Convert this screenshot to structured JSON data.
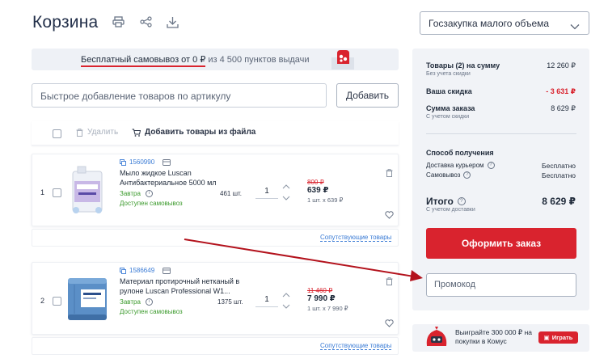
{
  "header": {
    "title": "Корзина",
    "icons": [
      "print-icon",
      "share-icon",
      "download-icon"
    ]
  },
  "promo": {
    "highlight": "Бесплатный самовывоз от 0 ₽",
    "rest": " из 4 500 пунктов выдачи"
  },
  "quick_add": {
    "placeholder": "Быстрое добавление товаров по артикулу",
    "button": "Добавить"
  },
  "toolbar": {
    "delete": "Удалить",
    "add_from_file": "Добавить товары из файла"
  },
  "items": [
    {
      "index": "1",
      "sku": "1560990",
      "name": "Мыло жидкое Luscan Антибактериальное 5000 мл",
      "delivery": "Завтра",
      "pickup": "Доступен самовывоз",
      "stock": "461 шт.",
      "qty": "1",
      "old_price": "800 ₽",
      "price": "639 ₽",
      "unit_price": "1 шт. x 639 ₽",
      "related": "Сопутствующие товары"
    },
    {
      "index": "2",
      "sku": "1586649",
      "name": "Материал протирочный нетканый в рулоне Luscan Professional W1...",
      "delivery": "Завтра",
      "pickup": "Доступен самовывоз",
      "stock": "1375 шт.",
      "qty": "1",
      "old_price": "11 460 ₽",
      "price": "7 990 ₽",
      "unit_price": "1 шт. x 7 990 ₽",
      "related": "Сопутствующие товары"
    }
  ],
  "purchase_type": {
    "selected": "Госзакупка малого объема"
  },
  "summary": {
    "goods_label": "Товары (2) на сумму",
    "goods_sub": "Без учета скидки",
    "goods_value": "12 260 ₽",
    "discount_label": "Ваша скидка",
    "discount_value": "- 3 631 ₽",
    "order_label": "Сумма заказа",
    "order_sub": "С учетом скидки",
    "order_value": "8 629 ₽",
    "method_label": "Способ получения",
    "courier_label": "Доставка курьером",
    "courier_value": "Бесплатно",
    "pickup_label": "Самовывоз",
    "pickup_value": "Бесплатно",
    "total_label": "Итого",
    "total_sub": "С учетом доставки",
    "total_value": "8 629 ₽",
    "checkout_button": "Оформить заказ",
    "promo_placeholder": "Промокод"
  },
  "game_banner": {
    "text": "Выиграйте 300 000 ₽ на покупки в Комус",
    "button": "Играть"
  },
  "colors": {
    "accent": "#d9232e",
    "link": "#3a7bd5",
    "success": "#3b9a2c"
  }
}
